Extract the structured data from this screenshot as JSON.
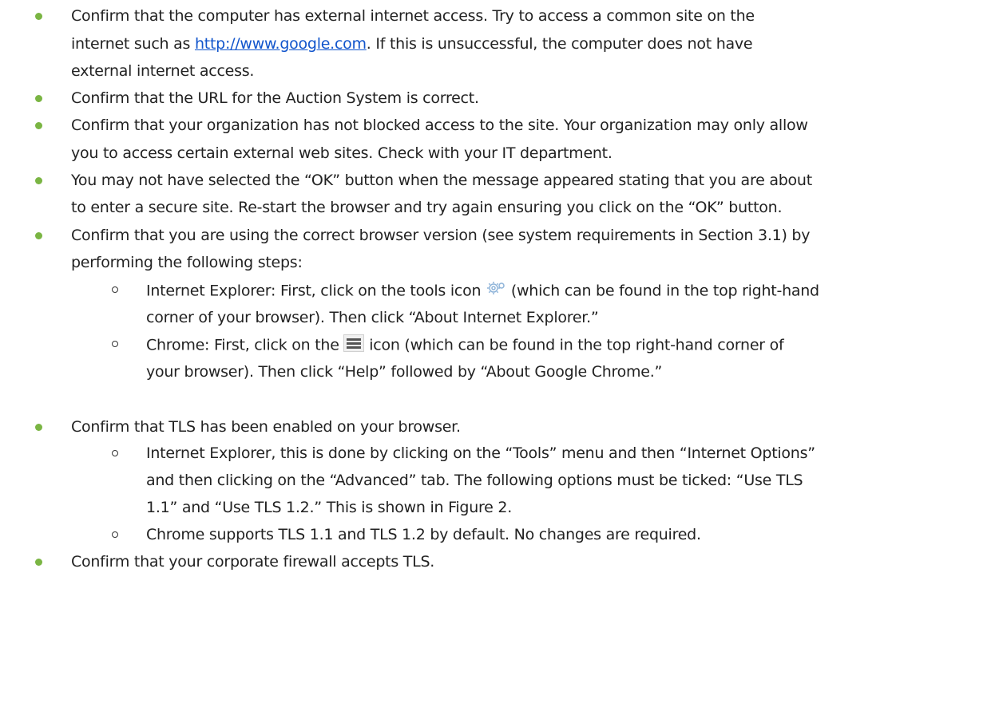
{
  "bullets": {
    "b1": {
      "line1": "Confirm that the computer has external internet access. Try to access a common site on the",
      "line2_pre": "internet such as ",
      "link": "http://www.google.com",
      "line2_post": ".  If this is unsuccessful, the computer does not have",
      "line3": "external internet access."
    },
    "b2": {
      "line1": "Confirm that the URL for the Auction System is correct."
    },
    "b3": {
      "line1": "Confirm that your organization has not blocked access to the site.  Your organization may only allow",
      "line2": "you to access certain external web sites.  Check with your IT department."
    },
    "b4": {
      "line1": "You may not have selected the “OK” button when the message appeared stating that you are about",
      "line2": "to enter a secure site.  Re-start the browser and try again ensuring you click on the “OK” button."
    },
    "b5": {
      "line1": "Confirm that you are using the correct browser version (see system requirements in Section 3.1) by",
      "line2": "performing the following steps:",
      "sub1": {
        "line1_pre": "Internet Explorer:  First, click on the tools icon ",
        "line1_post": " (which can be found in the top right-hand",
        "line2": "corner of your browser).  Then click “About Internet Explorer.”",
        "icon": "gear-icon"
      },
      "sub2": {
        "line1_pre": "Chrome:  First, click on the ",
        "line1_post": " icon (which can be found in the top right-hand corner of",
        "line2": "your browser).  Then click “Help” followed by “About Google Chrome.”",
        "icon": "menu-icon"
      }
    },
    "b6": {
      "line1": "Confirm that TLS has been enabled on your browser.",
      "sub1": {
        "line1": "Internet Explorer, this is done by clicking on the “Tools” menu and then “Internet Options”",
        "line2": "and then clicking on the “Advanced” tab.  The following options must be ticked:  “Use TLS",
        "line3": "1.1” and “Use TLS 1.2.”  This is shown in Figure 2."
      },
      "sub2": {
        "line1": "Chrome supports TLS 1.1 and TLS 1.2 by default.  No changes are required."
      }
    },
    "b7": {
      "line1": "Confirm that your corporate firewall accepts TLS."
    }
  },
  "colors": {
    "bullet": "#7ab543",
    "link": "#1155cc",
    "text": "#222222"
  }
}
